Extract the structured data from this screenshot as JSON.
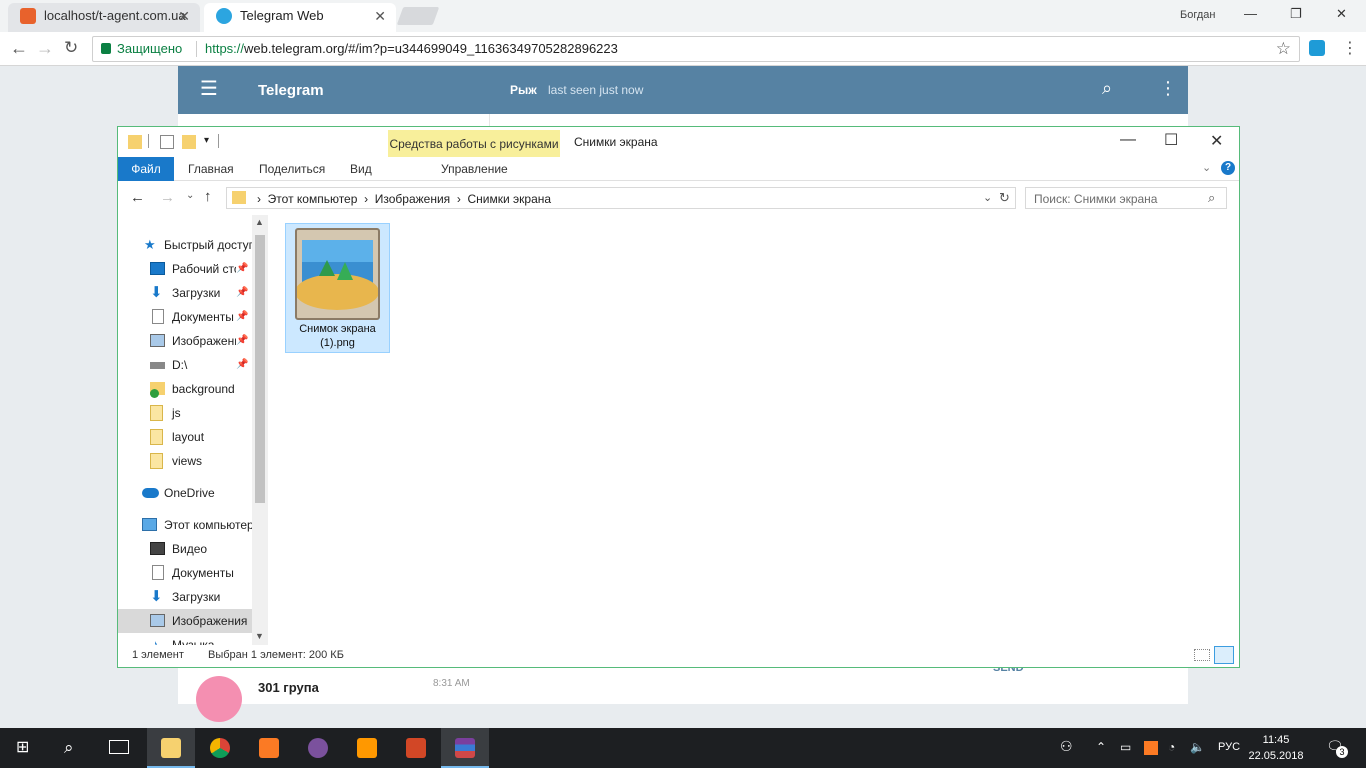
{
  "browser": {
    "tabs": [
      {
        "label": "localhost/t-agent.com.ua"
      },
      {
        "label": "Telegram Web"
      }
    ],
    "profile": "Богдан",
    "secure_label": "Защищено",
    "url_scheme": "https://",
    "url_rest": "web.telegram.org/#/im?p=u344699049_11636349705282896223"
  },
  "telegram": {
    "app_title": "Telegram",
    "peer_name": "Рыж",
    "peer_status": "last seen just now",
    "chat_preview_name": "301 група",
    "chat_preview_time": "8:31 AM",
    "send_label": "SEND"
  },
  "explorer": {
    "context_tab": "Средства работы с рисунками",
    "window_title": "Снимки экрана",
    "ribbon_tabs": [
      "Файл",
      "Главная",
      "Поделиться",
      "Вид",
      "Управление"
    ],
    "breadcrumbs": [
      "Этот компьютер",
      "Изображения",
      "Снимки экрана"
    ],
    "search_placeholder": "Поиск: Снимки экрана",
    "nav": {
      "quick_access": "Быстрый доступ",
      "pinned": [
        "Рабочий стол",
        "Загрузки",
        "Документы",
        "Изображения",
        "D:\\"
      ],
      "recent": [
        "background",
        "js",
        "layout",
        "views"
      ],
      "onedrive": "OneDrive",
      "this_pc": "Этот компьютер",
      "pc_items": [
        "Видео",
        "Документы",
        "Загрузки",
        "Изображения",
        "Музыка"
      ]
    },
    "file": {
      "name_line1": "Снимок экрана",
      "name_line2": "(1).png"
    },
    "status": {
      "count": "1 элемент",
      "selected": "Выбран 1 элемент: 200 КБ"
    }
  },
  "taskbar": {
    "lang": "РУС",
    "time": "11:45",
    "date": "22.05.2018",
    "notifications": "3"
  }
}
